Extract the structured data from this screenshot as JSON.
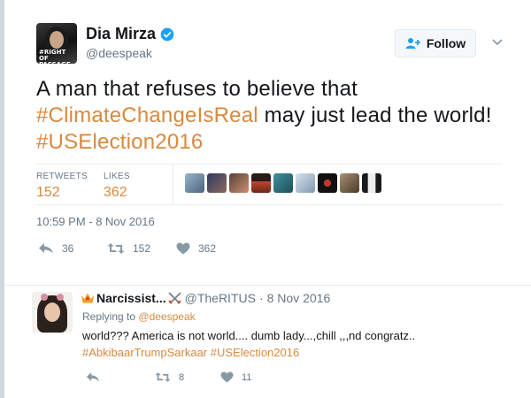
{
  "tweet": {
    "author": {
      "name": "Dia Mirza",
      "handle": "@deespeak",
      "avatar_text": "#RIGHT OF PASSAGE"
    },
    "follow_label": "Follow",
    "text_segments": [
      {
        "text": "A man that refuses to believe that ",
        "type": "text"
      },
      {
        "text": "#ClimateChangeIsReal",
        "type": "hashtag"
      },
      {
        "text": " may just lead the world! ",
        "type": "text"
      },
      {
        "text": "#USElection2016",
        "type": "hashtag"
      }
    ],
    "stats": {
      "retweets_label": "RETWEETS",
      "retweets": "152",
      "likes_label": "LIKES",
      "likes": "362"
    },
    "likers": [
      {
        "color": "#6b8aa8"
      },
      {
        "color": "#2f3b63"
      },
      {
        "color": "#7a5a4a"
      },
      {
        "color": "#b0402f"
      },
      {
        "color": "#3f8f9a"
      },
      {
        "color": "#8aa7c1"
      },
      {
        "color": "#1f1f1f"
      },
      {
        "color": "#8d7a5b"
      },
      {
        "color": "#2a2a2a"
      }
    ],
    "timestamp": "10:59 PM - 8 Nov 2016",
    "actions": {
      "reply_count": "36",
      "retweet_count": "152",
      "like_count": "362"
    }
  },
  "reply": {
    "author_name": "Narcissist...",
    "author_handle": "@TheRITUS",
    "separator": "·",
    "date": "8 Nov 2016",
    "replying_to_label": "Replying to",
    "replying_to_handle": "@deespeak",
    "text": "world??? America is not world.... dumb lady...,chill ,,,nd congratz..",
    "hashtags": "#AbkibaarTrumpSarkaar #USElection2016",
    "actions": {
      "reply_count": "",
      "retweet_count": "8",
      "like_count": "11"
    }
  },
  "colors": {
    "accent": "#d9893e",
    "verified": "#1da1f2",
    "muted": "#657786"
  }
}
